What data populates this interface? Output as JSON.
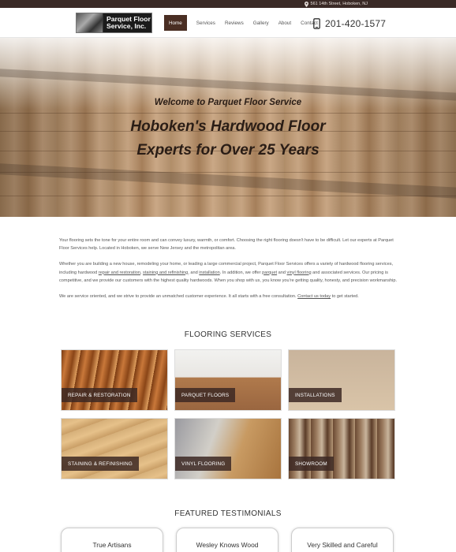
{
  "topbar": {
    "address": "561 14th Street, Hoboken, NJ",
    "icon": "map-pin-icon"
  },
  "header": {
    "logo_line1": "Parquet Floor",
    "logo_line2": "Service, Inc.",
    "phone": "201-420-1577",
    "phone_icon": "phone-icon"
  },
  "nav": {
    "items": [
      {
        "label": "Home",
        "active": true
      },
      {
        "label": "Services",
        "active": false
      },
      {
        "label": "Reviews",
        "active": false
      },
      {
        "label": "Gallery",
        "active": false
      },
      {
        "label": "About",
        "active": false
      },
      {
        "label": "Contact",
        "active": false
      }
    ]
  },
  "hero": {
    "welcome": "Welcome to Parquet Floor Service",
    "headline_line1": "Hoboken's Hardwood Floor",
    "headline_line2": "Experts for Over 25 Years"
  },
  "intro": {
    "p1": "Your flooring sets the tone for your entire room and can convey luxury, warmth, or comfort. Choosing the right flooring doesn't have to be difficult. Let our experts at Parquet Floor Services help. Located in Hoboken, we serve New Jersey and the metropolitan area.",
    "p2_a": "Whether you are building a new house, remodeling your home, or leading a large commercial project, Parquet Floor Services offers a variety of hardwood flooring services, including hardwood ",
    "p2_link1": "repair and restoration",
    "p2_b": ", ",
    "p2_link2": "staining and refinishing",
    "p2_c": ", and ",
    "p2_link3": "installation",
    "p2_d": ". In addition, we offer ",
    "p2_link4": "parquet",
    "p2_e": " and ",
    "p2_link5": "vinyl flooring",
    "p2_f": " and associated services. Our pricing is competitive, and we provide our customers with the highest quality hardwoods. When you shop with us, you know you're getting quality, honesty, and precision workmanship.",
    "p3_a": "We are service oriented, and we strive to provide an unmatched customer experience. It all starts with a free consultation. ",
    "p3_link": "Contact us today",
    "p3_b": " to get started."
  },
  "services": {
    "title": "FLOORING SERVICES",
    "tiles": [
      {
        "label": "REPAIR & RESTORATION"
      },
      {
        "label": "PARQUET FLOORS"
      },
      {
        "label": "INSTALLATIONS"
      },
      {
        "label": "STAINING & REFINISHING"
      },
      {
        "label": "VINYL FLOORING"
      },
      {
        "label": "SHOWROOM"
      }
    ]
  },
  "testimonials": {
    "title": "FEATURED TESTIMONIALS",
    "cards": [
      {
        "title": "True Artisans"
      },
      {
        "title": "Wesley Knows Wood"
      },
      {
        "title": "Very Skilled and Careful"
      }
    ]
  }
}
